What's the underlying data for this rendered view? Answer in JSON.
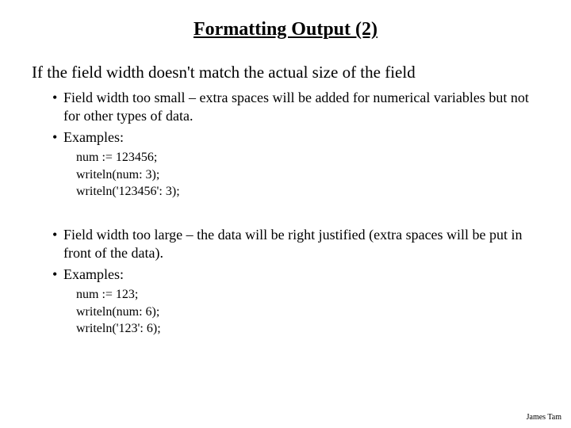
{
  "title": "Formatting Output (2)",
  "intro": "If the field width doesn't match the actual size of the field",
  "section1": {
    "bullet1": "Field width too small – extra spaces will be added for numerical variables but not for other types of data.",
    "bullet2": "Examples:",
    "code": {
      "line1": "num := 123456;",
      "line2": "writeln(num: 3);",
      "line3": "writeln('123456': 3);"
    }
  },
  "section2": {
    "bullet1": "Field width too large – the data will be right justified (extra spaces will be put in front of the data).",
    "bullet2": "Examples:",
    "code": {
      "line1": "num := 123;",
      "line2": "writeln(num: 6);",
      "line3": "writeln('123': 6);"
    }
  },
  "footer": "James Tam"
}
